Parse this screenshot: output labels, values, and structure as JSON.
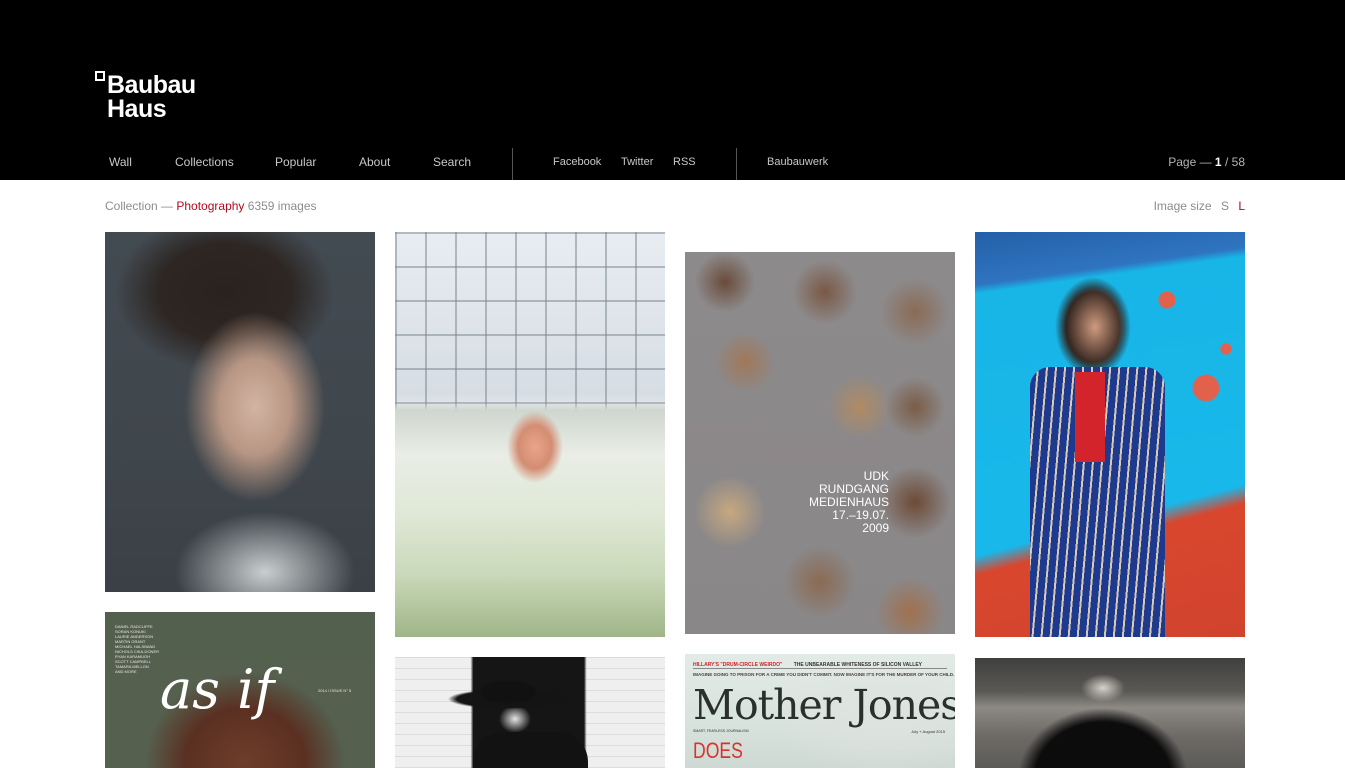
{
  "brand": {
    "logo_line1": "Baubau",
    "logo_line2": "Haus"
  },
  "nav": {
    "primary": [
      {
        "label": "Wall"
      },
      {
        "label": "Collections"
      },
      {
        "label": "Popular"
      },
      {
        "label": "About"
      },
      {
        "label": "Search"
      }
    ],
    "social": [
      {
        "label": "Facebook"
      },
      {
        "label": "Twitter"
      },
      {
        "label": "RSS"
      }
    ],
    "extra": [
      {
        "label": "Baubauwerk"
      }
    ]
  },
  "pager": {
    "prefix": "Page —",
    "current": "1",
    "separator": "/",
    "total": "58"
  },
  "collection": {
    "prefix": "Collection —",
    "name": "Photography",
    "count": "6359 images"
  },
  "image_size": {
    "label": "Image size",
    "options": [
      "S",
      "L"
    ],
    "selected": "L"
  },
  "colors": {
    "header_bg": "#000000",
    "accent": "#b00b1e",
    "muted_text": "#8c8c8c"
  },
  "images": [
    {
      "alt": "Portrait of a woman with dark hair"
    },
    {
      "alt": "Woman among white orchids in a greenhouse"
    },
    {
      "alt": "UDK Rundgang Medienhaus poster",
      "poster_lines": [
        "UDK",
        "RUNDGANG",
        "MEDIENHAUS",
        "17.–19.07.",
        "2009"
      ]
    },
    {
      "alt": "Man in striped suit against blue wall"
    },
    {
      "alt": "As If magazine cover",
      "credits": "DANIEL RADCLIFFE\nSORAN KONUKI\nLAURIE ANDERSON\nMARTIN GRANT\nMICHAEL HALSBAND\nNICHOLS CIKA-DONER\nRYAN KARAMUGH\nSCOTT CAMPBELL\nTAMARA MELLON\nAND MORE",
      "title": "as if",
      "issue": "2014 / ISSUE N° 5"
    },
    {
      "alt": "Man in black hat against brick wall"
    },
    {
      "alt": "Mother Jones magazine cover",
      "strap_red": "HILLARY'S \"DRUM-CIRCLE WEIRDO\"",
      "strap_black": "THE UNBEARABLE WHITENESS OF SILICON VALLEY",
      "sub": "IMAGINE GOING TO PRISON FOR A CRIME YOU DIDN'T COMMIT. NOW IMAGINE IT'S FOR THE MURDER OF YOUR CHILD.",
      "masthead": "Mother Jones",
      "tagline": "SMART, FEARLESS JOURNALISM",
      "date": "July + August 2015",
      "headline": "DOES"
    },
    {
      "alt": "Figure in black coat in a windy field"
    }
  ]
}
